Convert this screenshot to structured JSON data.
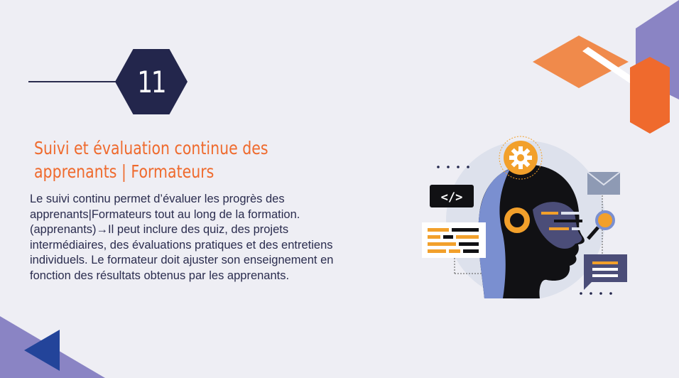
{
  "slide": {
    "number": "11",
    "title_line1": "Suivi et évaluation continue des",
    "title_line2": "apprenants | Formateurs",
    "body_lines": [
      "Le suivi continu permet d’évaluer les progrès des",
      "apprenants|Formateurs tout au long de la formation.",
      "(apprenants)→Il peut inclure des quiz, des projets",
      "intermédiaires, des évaluations pratiques et des entretiens",
      "individuels. Le formateur doit ajuster son enseignement en",
      "fonction des résultats obtenus par les apprenants."
    ]
  },
  "illustration": {
    "code_tag": "</>"
  },
  "colors": {
    "accent_orange": "#ef6a2d",
    "light_orange": "#f08a4b",
    "navy": "#23264c",
    "purple": "#8a84c4",
    "background": "#eeeef4",
    "gold": "#f2a02b"
  },
  "icons": [
    "gear-icon",
    "code-icon",
    "mail-icon",
    "chat-bubble-icon",
    "magnifier-icon",
    "back-arrow-icon"
  ]
}
